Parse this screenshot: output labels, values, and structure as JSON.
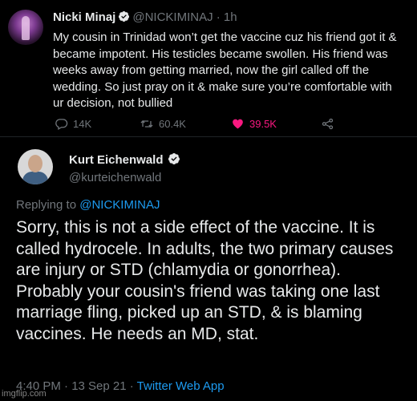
{
  "tweet1": {
    "name": "Nicki Minaj",
    "handle": "@NICKIMINAJ",
    "time": "· 1h",
    "text": "My cousin in Trinidad won’t get the vaccine cuz his friend got it & became impotent. His testicles became swollen. His friend was weeks away from getting married, now the girl called off the wedding. So just pray on it & make sure you’re comfortable with ur decision, not bullied",
    "replies": "14K",
    "retweets": "60.4K",
    "likes": "39.5K",
    "icons": [
      "reply-icon",
      "retweet-icon",
      "like-icon",
      "share-icon",
      "verified-badge-icon"
    ]
  },
  "tweet2": {
    "name": "Kurt Eichenwald",
    "handle": "@kurteichenwald",
    "replying_prefix": "Replying to ",
    "replying_to": "@NICKIMINAJ",
    "text": "Sorry, this is not a side effect of the vaccine. It is called hydrocele. In adults, the two primary causes are injury or STD (chlamydia or gonorrhea). Probably your cousin's friend was taking one last marriage fling, picked up an STD, & is blaming vaccines. He needs an MD, stat.",
    "timestamp": "4:40 PM · 13 Sep 21 · ",
    "app": "Twitter Web App"
  },
  "watermark": "imgflip.com",
  "colors": {
    "background": "#000000",
    "text": "#e7e9ea",
    "muted": "#71767b",
    "link": "#1d9bf0",
    "like": "#f91880"
  }
}
